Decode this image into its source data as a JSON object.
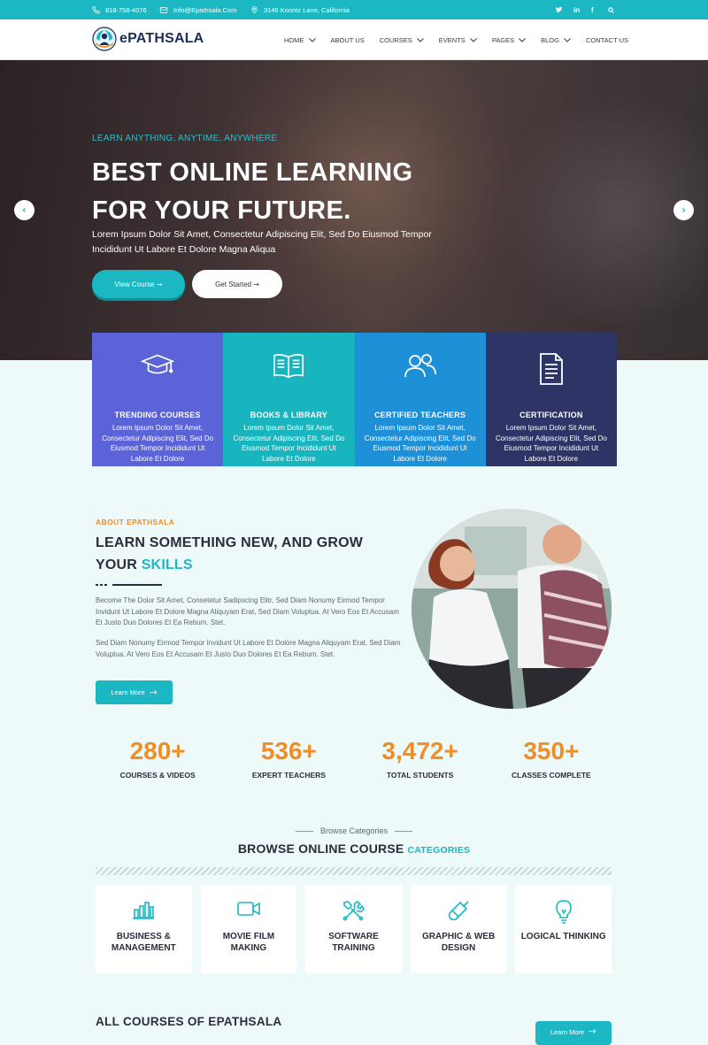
{
  "topbar": {
    "phone": "818-758-4076",
    "email": "Info@Epathsala.Com",
    "address": "3146 Koontz Lane, California",
    "social": [
      "twitter-icon",
      "linkedin-icon",
      "facebook-icon",
      "search-icon"
    ]
  },
  "nav": {
    "brand": "ePATHSALA",
    "items": [
      {
        "label": "HOME",
        "has_dropdown": true
      },
      {
        "label": "ABOUT US",
        "has_dropdown": false
      },
      {
        "label": "COURSES",
        "has_dropdown": true
      },
      {
        "label": "EVENTS",
        "has_dropdown": true
      },
      {
        "label": "PAGES",
        "has_dropdown": true
      },
      {
        "label": "BLOG",
        "has_dropdown": true
      },
      {
        "label": "CONTACT US",
        "has_dropdown": false
      }
    ]
  },
  "hero": {
    "tagline": "LEARN ANYTHING, ANYTIME, ANYWHERE",
    "title": "BEST ONLINE LEARNING FOR YOUR FUTURE.",
    "description": "Lorem Ipsum Dolor Sit Amet, Consectetur Adipiscing Elit, Sed Do Eiusmod Tempor Incididunt Ut Labore Et Dolore Magna Aliqua",
    "primary_button": "View Course ➞",
    "secondary_button": "Get Started ➞"
  },
  "features": [
    {
      "title": "TRENDING COURSES",
      "text": "Lorem Ipsum Dolor Sit Amet, Consectetur Adipiscing Elit, Sed Do Eiusmod Tempor Incididunt Ut Labore Et Dolore",
      "icon": "graduation-cap-icon",
      "color": "#5a63d8"
    },
    {
      "title": "BOOKS & LIBRARY",
      "text": "Lorem Ipsum Dolor Sit Amet, Consectetur Adipiscing Elit, Sed Do Eiusmod Tempor Incididunt Ut Labore Et Dolore",
      "icon": "book-icon",
      "color": "#18b5bf"
    },
    {
      "title": "CERTIFIED TEACHERS",
      "text": "Lorem Ipsum Dolor Sit Amet, Consectetur Adipiscing Elit, Sed Do Eiusmod Tempor Incididunt Ut Labore Et Dolore",
      "icon": "users-icon",
      "color": "#1e90d8"
    },
    {
      "title": "CERTIFICATION",
      "text": "Lorem Ipsum Dolor Sit Amet, Consectetur Adipiscing Elit, Sed Do Eiusmod Tempor Incididunt Ut Labore Et Dolore",
      "icon": "document-icon",
      "color": "#2e3566"
    }
  ],
  "about": {
    "subtitle": "ABOUT EPATHSALA",
    "heading_main": "LEARN SOMETHING NEW, AND GROW YOUR",
    "heading_highlight": "SKILLS",
    "paragraph1": "Become The Dolor Sit Amet, Consetetur Sadipscing Elitr, Sed Diam Nonumy Eirmod Tempor Invidunt Ut Labore Et Dolore Magna Aliquyam Erat, Sed Diam Voluptua. At Vero Eos Et Accusam Et Justo Duo Dolores Et Ea Rebum. Stet.",
    "paragraph2": "Sed Diam Nonumy Eirmod Tempor Invidunt Ut Labore Et Dolore Magna Aliquyam Erat, Sed Diam Voluptua. At Vero Eos Et Accusam Et Justo Duo Dolores Et Ea Rebum. Stet.",
    "button": "Learn More"
  },
  "stats": [
    {
      "value": "280+",
      "label": "COURSES & VIDEOS"
    },
    {
      "value": "536+",
      "label": "EXPERT TEACHERS"
    },
    {
      "value": "3,472+",
      "label": "TOTAL STUDENTS"
    },
    {
      "value": "350+",
      "label": "CLASSES COMPLETE"
    }
  ],
  "categories": {
    "kicker": "Browse Categories",
    "title_main": "BROWSE ONLINE COURSE",
    "title_highlight": "CATEGORIES",
    "items": [
      {
        "label": "BUSINESS & MANAGEMENT",
        "icon": "bar-chart-icon"
      },
      {
        "label": "MOVIE FILM MAKING",
        "icon": "video-camera-icon"
      },
      {
        "label": "SOFTWARE TRAINING",
        "icon": "tools-icon"
      },
      {
        "label": "GRAPHIC & WEB DESIGN",
        "icon": "paint-brush-icon"
      },
      {
        "label": "LOGICAL THINKING",
        "icon": "lightbulb-icon"
      }
    ]
  },
  "all_courses": {
    "title": "ALL COURSES OF EPATHSALA",
    "button": "Learn More"
  },
  "colors": {
    "accent": "#1bb8c4",
    "orange": "#f08d24",
    "dark": "#2c2c3c"
  }
}
